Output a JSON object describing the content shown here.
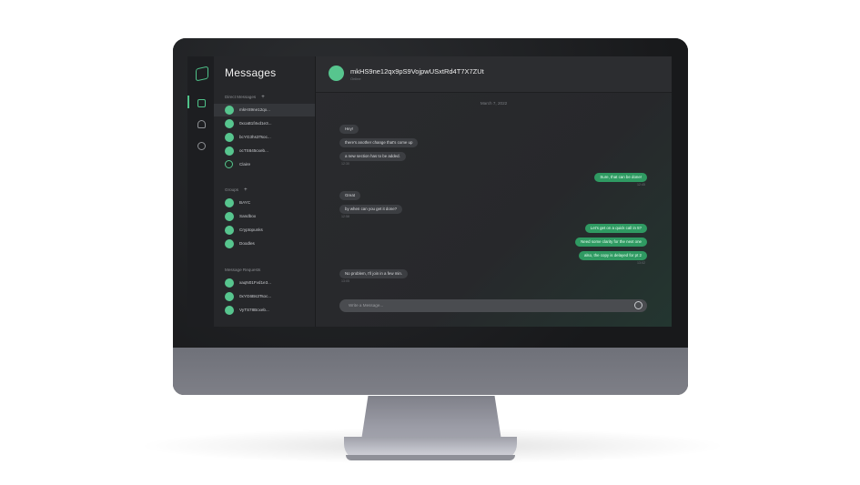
{
  "app": {
    "title": "Messages"
  },
  "sidebar": {
    "direct_label": "Direct Messages",
    "groups_label": "Groups",
    "requests_label": "Message Requests",
    "plus": "+",
    "direct": [
      {
        "name": "mkHS9ne12qx..."
      },
      {
        "name": "0xcaB1f4vd1e3..."
      },
      {
        "name": "bcYG3hs3Tsoc..."
      },
      {
        "name": "ocTS645cxeb..."
      },
      {
        "name": "Claire"
      }
    ],
    "groups": [
      {
        "name": "BAYC"
      },
      {
        "name": "Sandbox"
      },
      {
        "name": "Cryptopunks"
      },
      {
        "name": "Doodles"
      }
    ],
    "requests": [
      {
        "name": "xaqN01Fvd1e3..."
      },
      {
        "name": "0xYG6Bs3Tsoc..."
      },
      {
        "name": "VyTS78Bcxeb..."
      }
    ]
  },
  "chat": {
    "contact_name": "mkHS9ne12qx9pS9VojpwUSxtRd4T7X7ZUt",
    "contact_status": "Online",
    "date": "March 7, 2022",
    "messages": [
      {
        "dir": "in",
        "text": "Hey!"
      },
      {
        "dir": "in",
        "text": "there's another change that's come up"
      },
      {
        "dir": "in",
        "text": "a new section has to be added."
      },
      {
        "dir": "in_time",
        "text": "12:30"
      },
      {
        "dir": "out",
        "text": "Sure, that can be done!"
      },
      {
        "dir": "out_time",
        "text": "12:45"
      },
      {
        "dir": "in",
        "text": "Great"
      },
      {
        "dir": "in",
        "text": "by when can you get it done?"
      },
      {
        "dir": "in_time",
        "text": "12:58"
      },
      {
        "dir": "out",
        "text": "Let's get on a quick call in 5?"
      },
      {
        "dir": "out",
        "text": "Need some clarity for the next one"
      },
      {
        "dir": "out",
        "text": "also, the copy is delayed for pt 2"
      },
      {
        "dir": "out_time",
        "text": "13:02"
      },
      {
        "dir": "in",
        "text": "No problem, I'll join in a few min."
      },
      {
        "dir": "in_time",
        "text": "13:05"
      }
    ],
    "composer_placeholder": "Write a Message..."
  },
  "colors": {
    "accent": "#57c58e",
    "outgoing_bubble": "#2f9a62",
    "incoming_bubble": "#3c3e42"
  },
  "icons": [
    "logo-icon",
    "chat-icon",
    "users-icon",
    "settings-icon",
    "emoji-icon"
  ]
}
